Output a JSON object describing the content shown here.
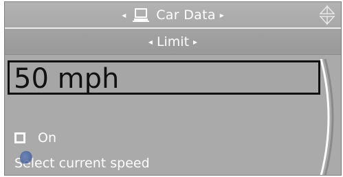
{
  "header": {
    "title": "Car Data",
    "left_arrow_icon": "triangle-left",
    "right_arrow_icon": "triangle-right",
    "menu_icon": "computer-icon",
    "nav_icon": "up-down-controller-icon"
  },
  "subheader": {
    "label": "Limit"
  },
  "main": {
    "value": "50 mph",
    "option_label": "On",
    "option_checked": false,
    "hint": "Select current speed"
  },
  "colors": {
    "background": "#a9a9a9",
    "text": "#ffffff",
    "value_text": "#111111"
  }
}
